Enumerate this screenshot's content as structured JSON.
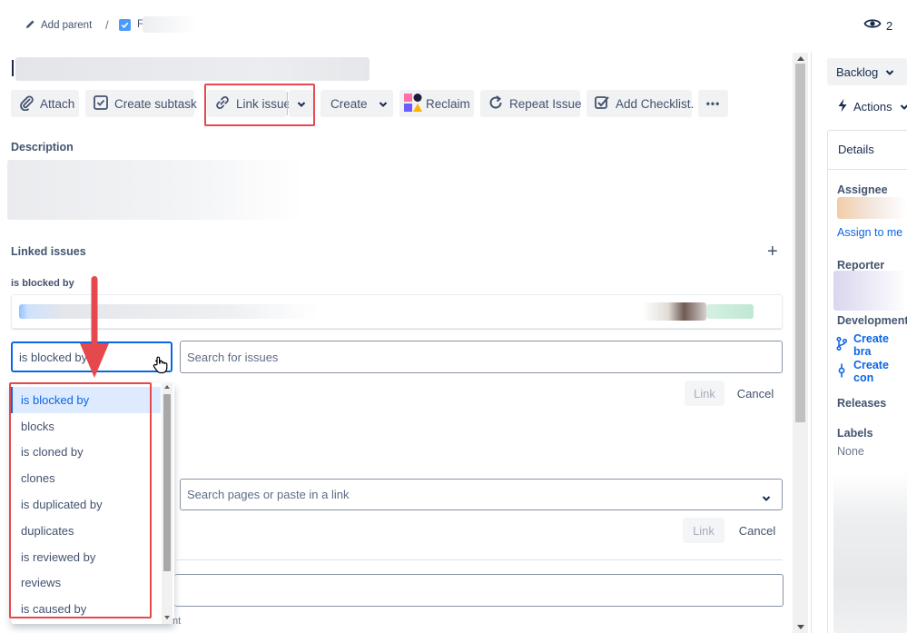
{
  "breadcrumb": {
    "add_parent": "Add parent",
    "separator": "/",
    "issue_key_partial": "F"
  },
  "watchers": {
    "count": "2"
  },
  "toolbar": {
    "attach": "Attach",
    "create_subtask": "Create subtask",
    "link_issue": "Link issue",
    "create": "Create",
    "reclaim": "Reclaim",
    "repeat_issue": "Repeat Issue",
    "add_checklist": "Add Checklist.",
    "more": "•••"
  },
  "description": {
    "heading": "Description"
  },
  "linked_issues": {
    "heading": "Linked issues",
    "add": "+",
    "group_label": "is blocked by",
    "relation_select": {
      "value": "is blocked by"
    },
    "search": {
      "placeholder": "Search for issues"
    },
    "link_label": "Link",
    "cancel_label": "Cancel"
  },
  "dropdown": {
    "options": [
      "is blocked by",
      "blocks",
      "is cloned by",
      "clones",
      "is duplicated by",
      "duplicates",
      "is reviewed by",
      "reviews",
      "is caused by"
    ],
    "selected": "is blocked by"
  },
  "web_link": {
    "search": {
      "placeholder": "Search pages or paste in a link"
    },
    "link_label": "Link",
    "cancel_label": "Cancel"
  },
  "bottom_hint": "nt",
  "sidebar": {
    "status": "Backlog",
    "actions": "Actions",
    "details": "Details",
    "assignee_label": "Assignee",
    "assign_to_me": "Assign to me",
    "reporter_label": "Reporter",
    "development_label": "Development",
    "create_branch": "Create bra",
    "create_commit": "Create con",
    "releases_label": "Releases",
    "labels_label": "Labels",
    "labels_value": "None"
  },
  "colors": {
    "accent": "#0c66e4",
    "annotation": "#e5484d",
    "status_bg": "#f1f2f4"
  }
}
